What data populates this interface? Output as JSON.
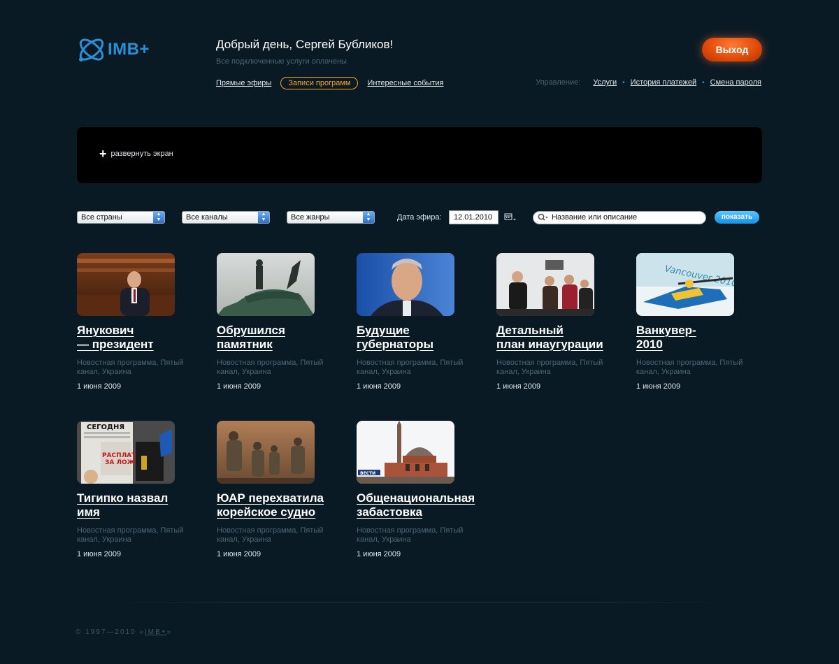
{
  "brand": {
    "logo_text": "IMB+"
  },
  "header": {
    "greeting": "Добрый день, Сергей Бубликов!",
    "subline": "Все подключенные услуги оплачены",
    "logout_label": "Выход"
  },
  "nav": [
    {
      "label": "Прямые эфиры",
      "active": false
    },
    {
      "label": "Записи программ",
      "active": true
    },
    {
      "label": "Интересные события",
      "active": false
    }
  ],
  "manage": {
    "label": "Управление:",
    "links": [
      "Услуги",
      "История платежей",
      "Смена пароля"
    ]
  },
  "player": {
    "expand_label": "развернуть экран"
  },
  "filters": {
    "country": "Все страны",
    "channel": "Все каналы",
    "genre": "Все жанры",
    "date_label": "Дата эфира:",
    "date_value": "12.01.2010",
    "search_placeholder": "Название или описание",
    "show_label": "показать"
  },
  "cards": [
    {
      "title": "Янукович\n— президент",
      "meta": "Новостная программа, Пятый канал, Украина",
      "date": "1 июня 2009",
      "thumb": "parliament"
    },
    {
      "title": "Обрушился\nпамятник",
      "meta": "Новостная программа, Пятый канал, Украина",
      "date": "1 июня 2009",
      "thumb": "monument"
    },
    {
      "title": "Будущие\nгубернаторы",
      "meta": "Новостная программа, Пятый канал, Украина",
      "date": "1 июня 2009",
      "thumb": "portrait"
    },
    {
      "title": "Детальный\nплан инаугурации",
      "meta": "Новостная программа, Пятый канал, Украина",
      "date": "1 июня 2009",
      "thumb": "crowd"
    },
    {
      "title": "Ванкувер-\n2010",
      "meta": "Новостная программа, Пятый канал, Украина",
      "date": "1 июня 2009",
      "thumb": "biathlon"
    },
    {
      "title": "Тигипко назвал\nимя",
      "meta": "Новостная программа, Пятый канал, Украина",
      "date": "1 июня 2009",
      "thumb": "newspaper"
    },
    {
      "title": "ЮАР перехватила\nкорейское судно",
      "meta": "Новостная программа, Пятый канал, Украина",
      "date": "1 июня 2009",
      "thumb": "soldiers"
    },
    {
      "title": "Общенациональная\nзабастовка",
      "meta": "Новостная программа, Пятый канал, Украина",
      "date": "1 июня 2009",
      "thumb": "mosque"
    }
  ],
  "thumb_text": {
    "newspaper_masthead": "СЕГОДНЯ",
    "newspaper_headline_1": "РАСПЛАТА",
    "newspaper_headline_2": "ЗА ЛОЖЬ",
    "biathlon_banner": "Vancouver 2010",
    "mosque_channel": "ВЕСТИ"
  },
  "footer": {
    "copyright": "© 1997—2010 «",
    "brand": "IMB+",
    "close": "»"
  }
}
